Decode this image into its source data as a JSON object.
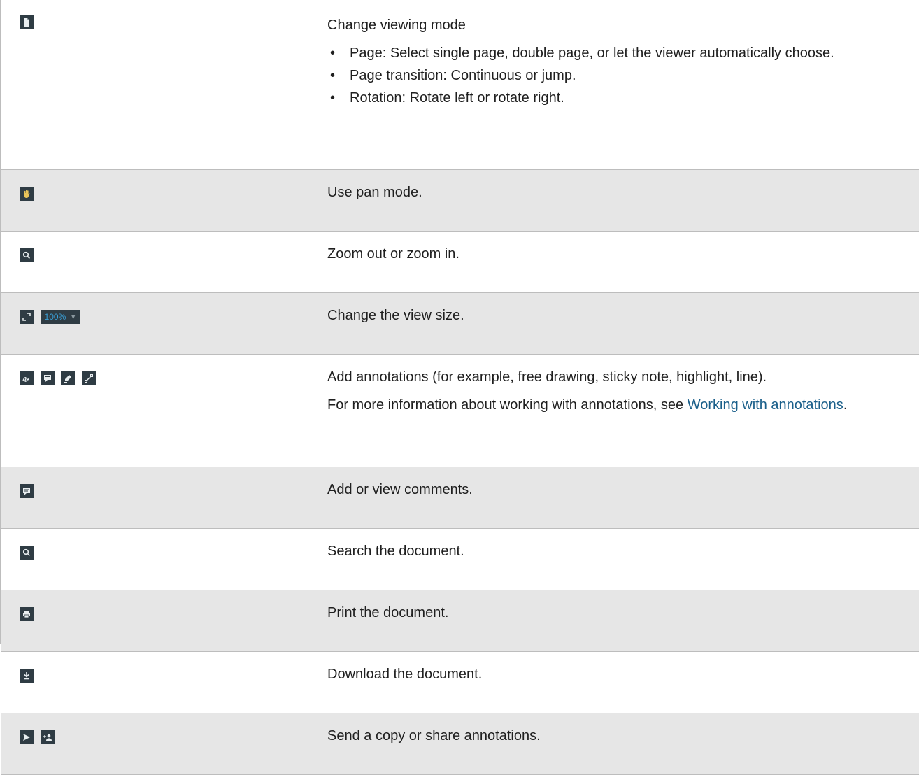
{
  "rows": [
    {
      "icons": [
        "page-icon"
      ],
      "title": "Change viewing mode",
      "bullets": [
        "Page: Select single page, double page, or let the viewer automatically choose.",
        "Page transition: Continuous or jump.",
        "Rotation: Rotate left or rotate right."
      ]
    },
    {
      "icons": [
        "pan-hand-icon"
      ],
      "text": "Use pan mode."
    },
    {
      "icons": [
        "zoom-icon"
      ],
      "text": "Zoom out or zoom in."
    },
    {
      "icons": [
        "fit-view-icon"
      ],
      "zoom_value": "100%",
      "text": "Change the view size."
    },
    {
      "icons": [
        "free-draw-icon",
        "sticky-note-icon",
        "highlight-icon",
        "line-icon"
      ],
      "text": "Add annotations (for example, free drawing, sticky note, highlight, line).",
      "more_prefix": "For more information about working with annotations, see ",
      "more_link": "Working with annotations",
      "more_suffix": "."
    },
    {
      "icons": [
        "comment-icon"
      ],
      "text": "Add or view comments."
    },
    {
      "icons": [
        "search-icon"
      ],
      "text": "Search the document."
    },
    {
      "icons": [
        "print-icon"
      ],
      "text": "Print the document."
    },
    {
      "icons": [
        "download-icon"
      ],
      "text": "Download the document."
    },
    {
      "icons": [
        "send-icon",
        "share-user-icon"
      ],
      "text": "Send a copy or share annotations."
    }
  ],
  "bullet_char": "•",
  "colors": {
    "icon_bg": "#2f3c44",
    "icon_fg": "#e9eef0",
    "zoom_text": "#3aa0d8",
    "link": "#1a5f8a",
    "shaded_row": "#e6e6e6"
  }
}
